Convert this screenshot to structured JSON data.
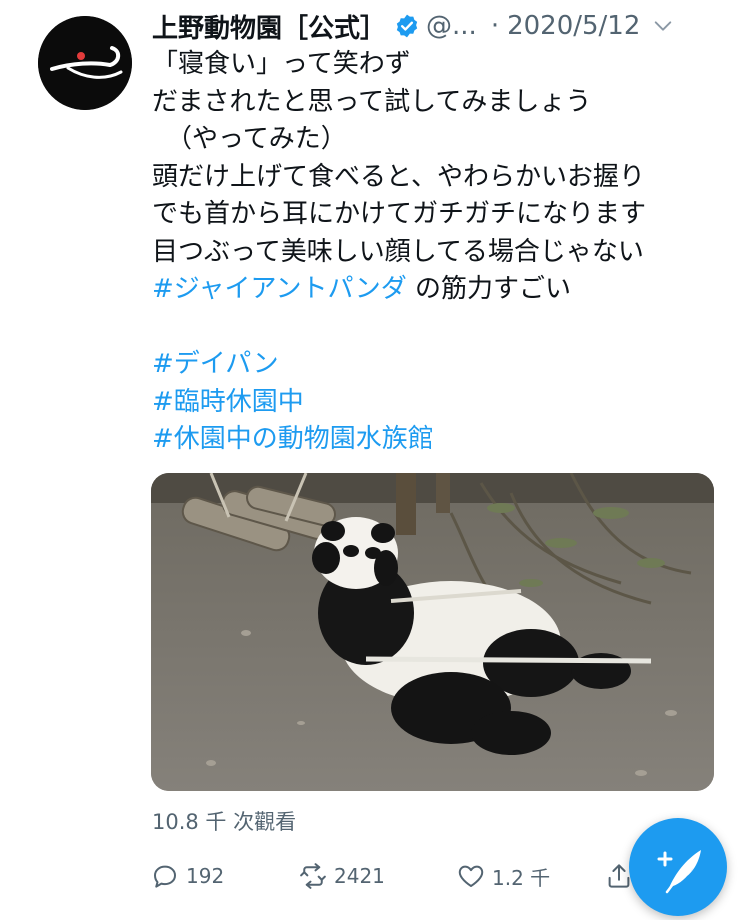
{
  "tweet": {
    "author_name": "上野動物園［公式］",
    "handle": "@...",
    "separator": "·",
    "date": "2020/5/12",
    "text_lines": [
      "「寝食い」って笑わず",
      "だまされたと思って試してみましょう",
      "（やってみた）",
      "頭だけ上げて食べると、やわらかいお握り",
      "でも首から耳にかけてガチガチになります",
      "目つぶって美味しい顔してる場合じゃない"
    ],
    "hashtag_inline": "#ジャイアントパンダ",
    "after_hashtag": " の筋力すごい",
    "hashtags": [
      "#デイパン",
      "#臨時休園中",
      "#休園中の動物園水族館"
    ]
  },
  "media": {
    "views": "10.8 千 次觀看"
  },
  "actions": {
    "replies": "192",
    "retweets": "2421",
    "likes": "1.2 千"
  },
  "colors": {
    "accent": "#1d9bf0",
    "text": "#0f1419",
    "muted": "#536471"
  },
  "icons": {
    "verified": "verified-badge-icon",
    "caret": "chevron-down-icon",
    "reply": "reply-icon",
    "retweet": "retweet-icon",
    "like": "heart-icon",
    "share": "share-icon",
    "compose": "compose-icon"
  }
}
